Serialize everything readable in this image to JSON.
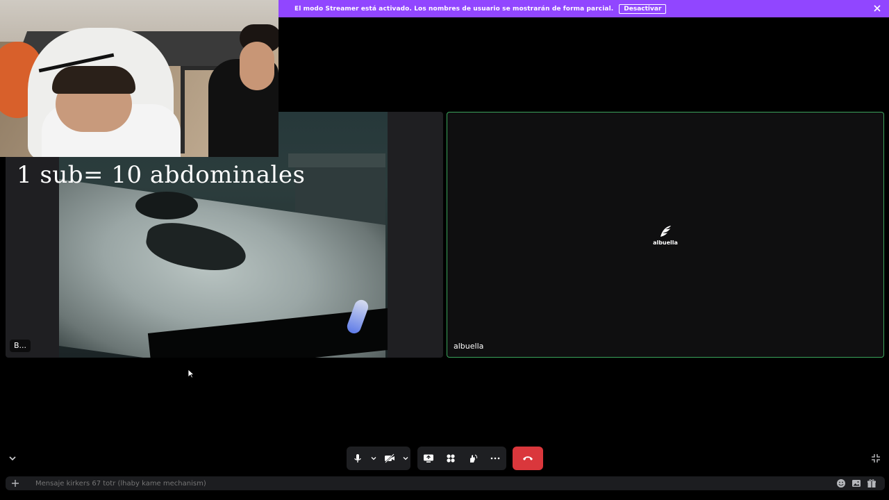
{
  "banner": {
    "text": "El modo Streamer está activado. Los nombres de usuario se mostrarán de forma parcial.",
    "button_label": "Desactivar",
    "background": "#9146ff"
  },
  "overlay": {
    "text": "1 sub= 10 abdominales"
  },
  "tiles": {
    "left": {
      "name": "B..."
    },
    "right": {
      "logo_label": "albuella",
      "name": "albuella",
      "border_color": "#3ba55c"
    }
  },
  "controls": {
    "icons": [
      "microphone-icon",
      "camera-off-icon",
      "screen-share-icon",
      "activities-icon",
      "soundboard-icon",
      "more-icon",
      "hang-up-icon"
    ],
    "end_call_color": "#da373c"
  },
  "chat": {
    "placeholder": "Mensaje kirkers 67 totr (lhaby kame mechanism)"
  }
}
